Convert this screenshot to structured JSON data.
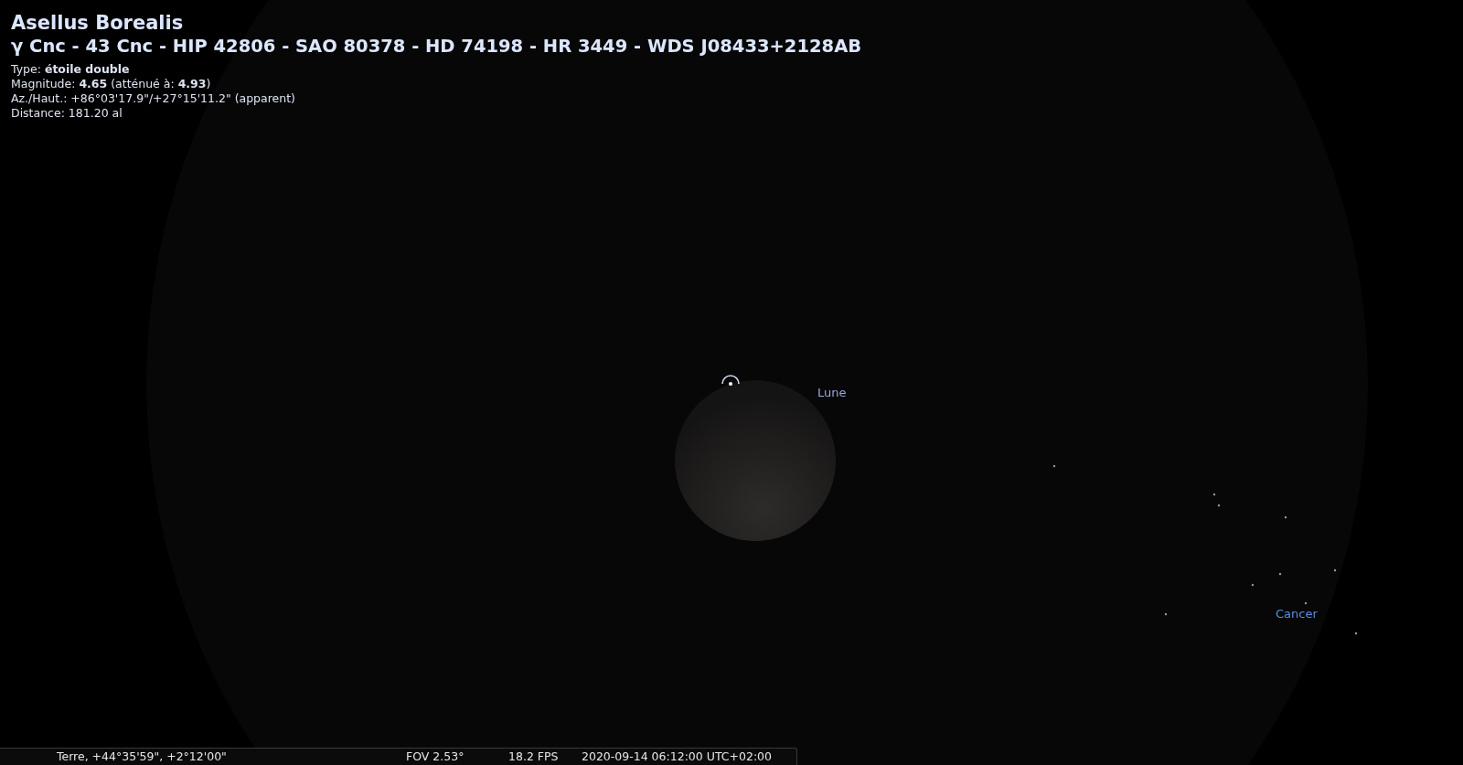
{
  "object_info": {
    "name": "Asellus Borealis",
    "designations": "γ Cnc - 43 Cnc - HIP 42806 - SAO 80378 - HD 74198 - HR 3449 - WDS J08433+2128AB",
    "lines": [
      "Type: **étoile double**",
      "Magnitude: **4.65** (atténué à: **4.93**)",
      "Az./Haut.: +86°03'17.9\"/+27°15'11.2\" (apparent)",
      "Distance: 181.20 al"
    ]
  },
  "sky_labels": [
    {
      "text": "Lune",
      "kind": "planet"
    },
    {
      "text": "Cancer",
      "kind": "constellation"
    }
  ],
  "status_bar": {
    "location": "Terre, +44°35'59\", +2°12'00\"",
    "fov": "FOV 2.53°",
    "fps": "18.2 FPS",
    "datetime": "2020-09-14 06:12:00 UTC+02:00"
  }
}
